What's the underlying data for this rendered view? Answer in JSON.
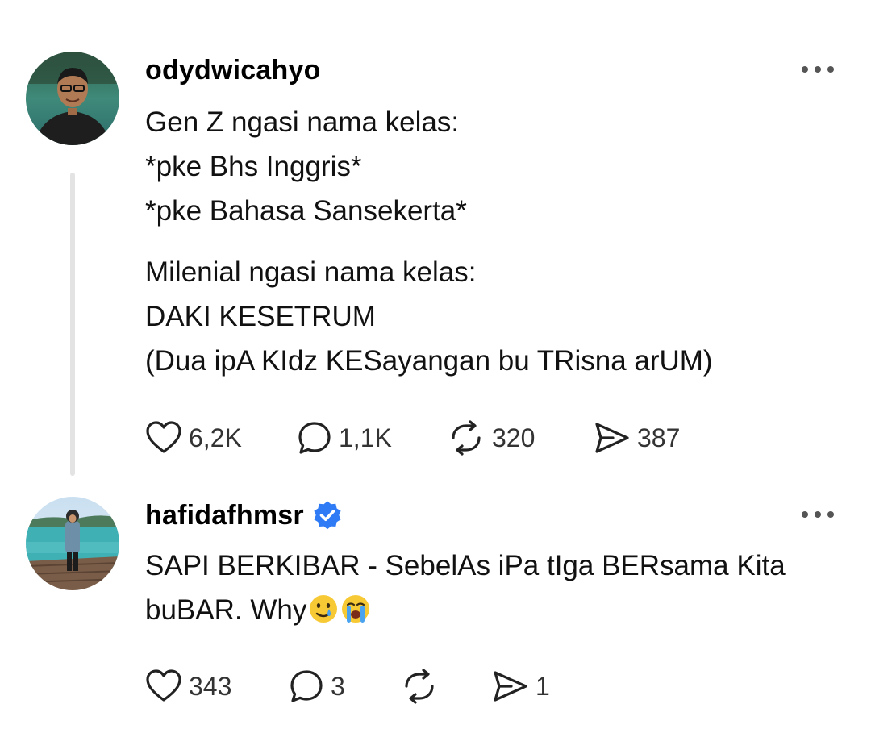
{
  "posts": [
    {
      "username": "odydwicahyo",
      "verified": false,
      "body_paragraphs": [
        [
          "Gen Z ngasi nama kelas:",
          "*pke Bhs Inggris*",
          "*pke Bahasa Sansekerta*"
        ],
        [
          "Milenial ngasi nama kelas:",
          "DAKI KESETRUM",
          "(Dua ipA KIdz KESayangan bu TRisna arUM)"
        ]
      ],
      "stats": {
        "likes": "6,2K",
        "replies": "1,1K",
        "reposts": "320",
        "shares": "387"
      }
    },
    {
      "username": "hafidafhmsr",
      "verified": true,
      "body_lines": [
        "SAPI BERKIBAR - SebelAs iPa tIga BERsama Kita",
        "buBAR. Why"
      ],
      "emojis": [
        "smiling-face-with-tear",
        "loudly-crying-face"
      ],
      "stats": {
        "likes": "343",
        "replies": "3",
        "reposts": "",
        "shares": "1"
      }
    }
  ],
  "colors": {
    "text": "#111111",
    "verified_blue": "#2f7bf5",
    "thread_line": "#e3e3e3",
    "icon": "#333333"
  },
  "icons": [
    "heart-icon",
    "comment-icon",
    "repost-icon",
    "share-icon",
    "more-icon",
    "verified-badge-icon"
  ]
}
